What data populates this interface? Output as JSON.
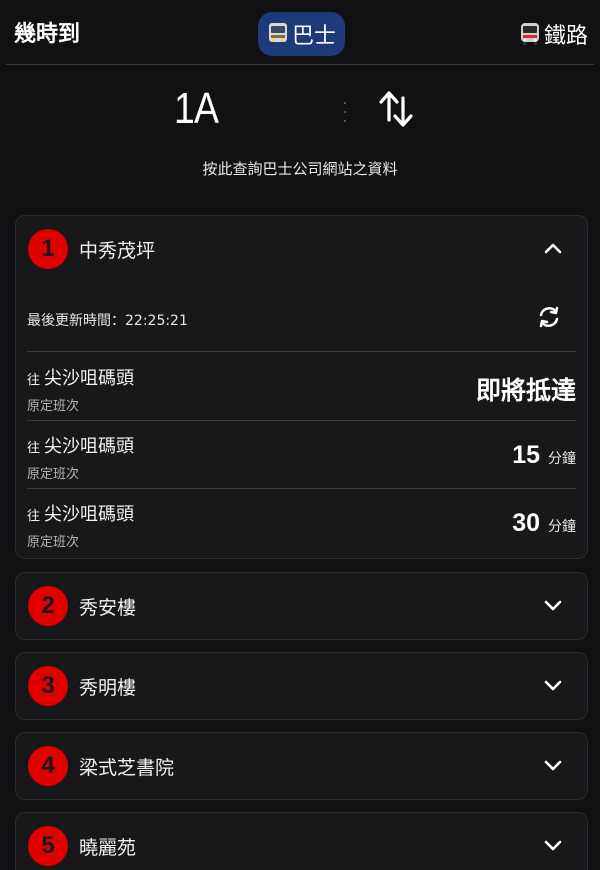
{
  "header": {
    "app_title": "幾時到",
    "bus_tab_label": "巴士",
    "bus_tab_icon": "bus-icon",
    "rail_tab_label": "鐵路",
    "rail_tab_icon": "train-icon",
    "accent_color": "#1d3a7a"
  },
  "route": {
    "number": "1A",
    "info_link": "按此查詢巴士公司網站之資料"
  },
  "stops": [
    {
      "seq": "1",
      "name": "中秀茂坪",
      "expanded": true,
      "last_updated_label": "最後更新時間：22:25:21",
      "etas": [
        {
          "to": "往",
          "destination": "尖沙咀碼頭",
          "remark": "原定班次",
          "status": "即將抵達"
        },
        {
          "to": "往",
          "destination": "尖沙咀碼頭",
          "remark": "原定班次",
          "minutes": "15",
          "unit": "分鐘"
        },
        {
          "to": "往",
          "destination": "尖沙咀碼頭",
          "remark": "原定班次",
          "minutes": "30",
          "unit": "分鐘"
        }
      ]
    },
    {
      "seq": "2",
      "name": "秀安樓",
      "expanded": false
    },
    {
      "seq": "3",
      "name": "秀明樓",
      "expanded": false
    },
    {
      "seq": "4",
      "name": "梁式芝書院",
      "expanded": false
    },
    {
      "seq": "5",
      "name": "曉麗苑",
      "expanded": false
    }
  ],
  "colors": {
    "badge_red": "#e00000",
    "background": "#111113",
    "card": "#18181b"
  }
}
